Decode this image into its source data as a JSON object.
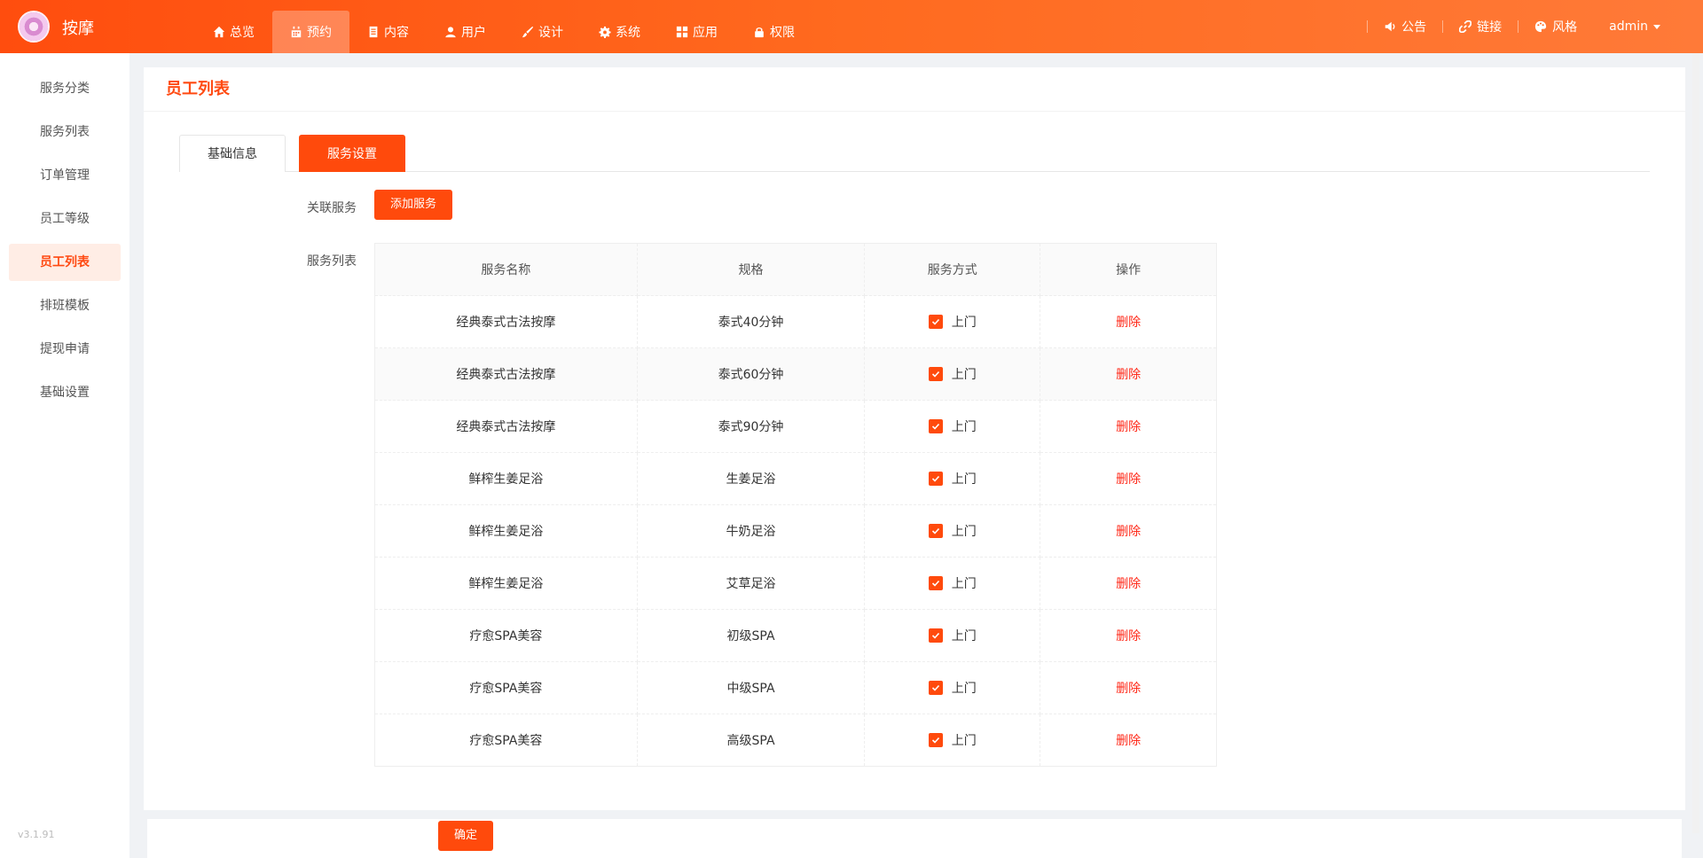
{
  "app": {
    "brand": "按摩"
  },
  "topnav": [
    {
      "label": "总览",
      "icon": "home-icon",
      "active": false
    },
    {
      "label": "预约",
      "icon": "calendar-icon",
      "active": true
    },
    {
      "label": "内容",
      "icon": "document-icon",
      "active": false
    },
    {
      "label": "用户",
      "icon": "user-icon",
      "active": false
    },
    {
      "label": "设计",
      "icon": "brush-icon",
      "active": false
    },
    {
      "label": "系统",
      "icon": "gear-icon",
      "active": false
    },
    {
      "label": "应用",
      "icon": "grid-icon",
      "active": false
    },
    {
      "label": "权限",
      "icon": "lock-icon",
      "active": false
    }
  ],
  "topright": {
    "notice": "公告",
    "link": "链接",
    "style": "风格",
    "user": "admin"
  },
  "sidebar": {
    "items": [
      {
        "label": "服务分类"
      },
      {
        "label": "服务列表"
      },
      {
        "label": "订单管理"
      },
      {
        "label": "员工等级"
      },
      {
        "label": "员工列表",
        "active": true
      },
      {
        "label": "排班模板"
      },
      {
        "label": "提现申请"
      },
      {
        "label": "基础设置"
      }
    ],
    "version": "v3.1.91"
  },
  "page": {
    "title": "员工列表",
    "tabs": [
      {
        "label": "基础信息"
      },
      {
        "label": "服务设置",
        "active": true
      }
    ],
    "related_label": "关联服务",
    "add_button": "添加服务",
    "list_label": "服务列表",
    "confirm_button": "确定"
  },
  "table": {
    "headers": [
      "服务名称",
      "规格",
      "服务方式",
      "操作"
    ],
    "rows": [
      {
        "name": "经典泰式古法按摩",
        "spec": "泰式40分钟",
        "method": "上门",
        "action": "删除"
      },
      {
        "name": "经典泰式古法按摩",
        "spec": "泰式60分钟",
        "method": "上门",
        "action": "删除"
      },
      {
        "name": "经典泰式古法按摩",
        "spec": "泰式90分钟",
        "method": "上门",
        "action": "删除"
      },
      {
        "name": "鲜榨生姜足浴",
        "spec": "生姜足浴",
        "method": "上门",
        "action": "删除"
      },
      {
        "name": "鲜榨生姜足浴",
        "spec": "牛奶足浴",
        "method": "上门",
        "action": "删除"
      },
      {
        "name": "鲜榨生姜足浴",
        "spec": "艾草足浴",
        "method": "上门",
        "action": "删除"
      },
      {
        "name": "疗愈SPA美容",
        "spec": "初级SPA",
        "method": "上门",
        "action": "删除"
      },
      {
        "name": "疗愈SPA美容",
        "spec": "中级SPA",
        "method": "上门",
        "action": "删除"
      },
      {
        "name": "疗愈SPA美容",
        "spec": "高级SPA",
        "method": "上门",
        "action": "删除"
      }
    ]
  },
  "colors": {
    "accent": "#ff4a0c",
    "danger": "#ff2a1a"
  }
}
